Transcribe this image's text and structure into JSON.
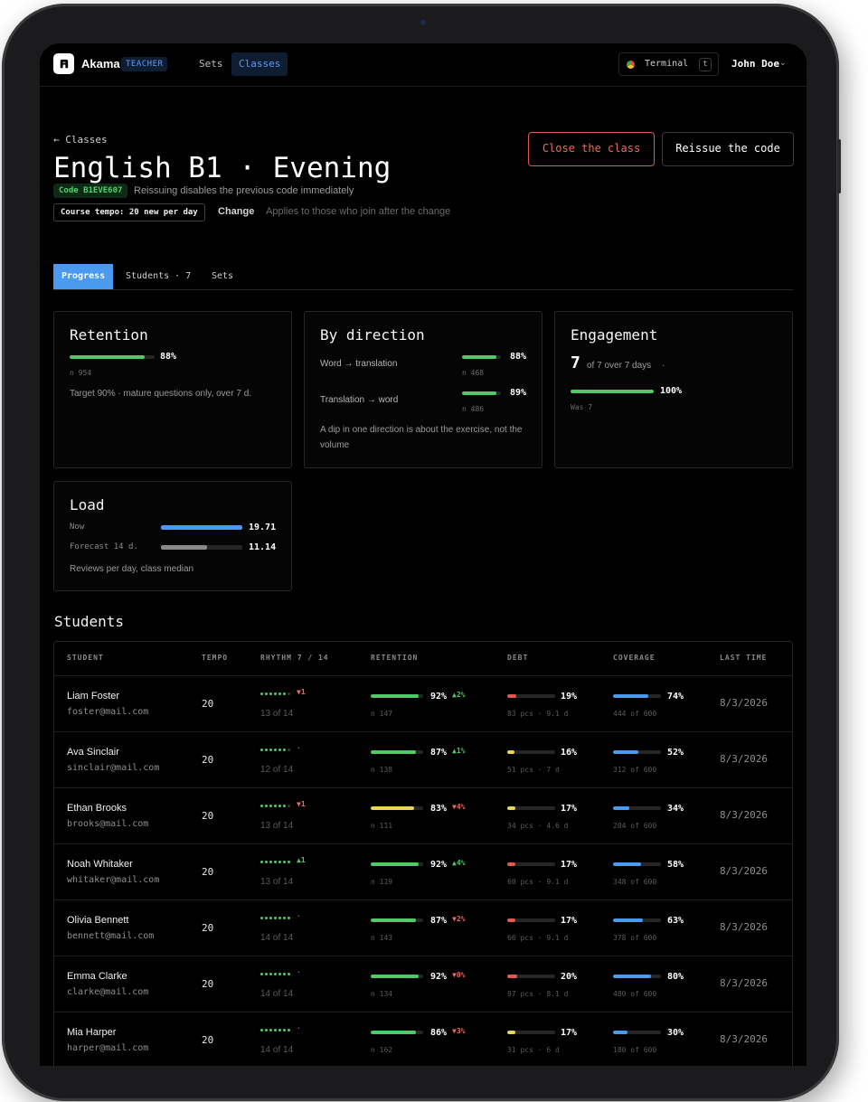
{
  "header": {
    "brand": "Akama",
    "role": "TEACHER",
    "nav": [
      {
        "label": "Sets",
        "active": false
      },
      {
        "label": "Classes",
        "active": true
      }
    ],
    "terminal_label": "Terminal",
    "terminal_key": "t",
    "user_name": "John Doe"
  },
  "page": {
    "back_label": "← Classes",
    "title": "English B1 · Evening",
    "code_label": "Code B1EVE607",
    "code_note": "Reissuing disables the previous code immediately",
    "tempo_label": "Course tempo: 20 new per day",
    "change_label": "Change",
    "change_note": "Applies to those who join after the change",
    "close_button": "Close the class",
    "reissue_button": "Reissue the code"
  },
  "tabs": [
    {
      "label": "Progress",
      "active": true
    },
    {
      "label": "Students · 7",
      "active": false
    },
    {
      "label": "Sets",
      "active": false
    }
  ],
  "retention": {
    "title": "Retention",
    "value": 88,
    "value_label": "88%",
    "n_label": "n 954",
    "note": "Target 90% · mature questions only, over 7 d."
  },
  "direction": {
    "title": "By direction",
    "items": [
      {
        "label": "Word → translation",
        "value": 88,
        "value_label": "88%",
        "n_label": "n 468"
      },
      {
        "label": "Translation → word",
        "value": 89,
        "value_label": "89%",
        "n_label": "n 486"
      }
    ],
    "note": "A dip in one direction is about the exercise, not the volume"
  },
  "engagement": {
    "title": "Engagement",
    "big_number": "7",
    "sub": "of 7 over 7 days",
    "sub_dot": "·",
    "value": 100,
    "value_label": "100%",
    "was_label": "Was 7"
  },
  "load": {
    "title": "Load",
    "rows": [
      {
        "label": "Now",
        "value": 19.71,
        "value_label": "19.71",
        "fill": 1.0
      },
      {
        "label": "Forecast 14 d.",
        "value": 11.14,
        "value_label": "11.14",
        "fill": 0.57
      }
    ],
    "note": "Reviews per day, class median"
  },
  "students": {
    "title": "Students",
    "columns": [
      "STUDENT",
      "TEMPO",
      "RHYTHM 7 / 14",
      "RETENTION",
      "DEBT",
      "COVERAGE",
      "LAST TIME"
    ],
    "rows": [
      {
        "name": "Liam Foster",
        "email": "foster@mail.com",
        "tempo": "20",
        "dots_on": 6,
        "rhythm_delta": "▼1",
        "rhythm_dir": "down",
        "rhythm_sub": "13 of 14",
        "retention": 92,
        "retention_label": "92%",
        "retention_delta": "▲2%",
        "retention_dir": "up",
        "retention_color": "g",
        "retention_n": "n 147",
        "debt": 19,
        "debt_label": "19%",
        "debt_color": "r",
        "debt_sub": "83 pcs · 9.1 d",
        "coverage": 74,
        "coverage_label": "74%",
        "coverage_sub": "444 of 600",
        "last": "8/3/2026"
      },
      {
        "name": "Ava Sinclair",
        "email": "sinclair@mail.com",
        "tempo": "20",
        "dots_on": 6,
        "rhythm_delta": "·",
        "rhythm_dir": "flat",
        "rhythm_sub": "12 of 14",
        "retention": 87,
        "retention_label": "87%",
        "retention_delta": "▲1%",
        "retention_dir": "up",
        "retention_color": "g",
        "retention_n": "n 138",
        "debt": 16,
        "debt_label": "16%",
        "debt_color": "y",
        "debt_sub": "51 pcs · 7 d",
        "coverage": 52,
        "coverage_label": "52%",
        "coverage_sub": "312 of 600",
        "last": "8/3/2026"
      },
      {
        "name": "Ethan Brooks",
        "email": "brooks@mail.com",
        "tempo": "20",
        "dots_on": 6,
        "rhythm_delta": "▼1",
        "rhythm_dir": "down",
        "rhythm_sub": "13 of 14",
        "retention": 83,
        "retention_label": "83%",
        "retention_delta": "▼4%",
        "retention_dir": "down",
        "retention_color": "y",
        "retention_n": "n 111",
        "debt": 17,
        "debt_label": "17%",
        "debt_color": "y",
        "debt_sub": "34 pcs · 4.6 d",
        "coverage": 34,
        "coverage_label": "34%",
        "coverage_sub": "204 of 600",
        "last": "8/3/2026"
      },
      {
        "name": "Noah Whitaker",
        "email": "whitaker@mail.com",
        "tempo": "20",
        "dots_on": 7,
        "rhythm_delta": "▲1",
        "rhythm_dir": "up",
        "rhythm_sub": "13 of 14",
        "retention": 92,
        "retention_label": "92%",
        "retention_delta": "▲4%",
        "retention_dir": "up",
        "retention_color": "g",
        "retention_n": "n 119",
        "debt": 17,
        "debt_label": "17%",
        "debt_color": "r",
        "debt_sub": "60 pcs · 9.1 d",
        "coverage": 58,
        "coverage_label": "58%",
        "coverage_sub": "348 of 600",
        "last": "8/3/2026"
      },
      {
        "name": "Olivia Bennett",
        "email": "bennett@mail.com",
        "tempo": "20",
        "dots_on": 7,
        "rhythm_delta": "·",
        "rhythm_dir": "flat",
        "rhythm_sub": "14 of 14",
        "retention": 87,
        "retention_label": "87%",
        "retention_delta": "▼2%",
        "retention_dir": "down",
        "retention_color": "g",
        "retention_n": "n 143",
        "debt": 17,
        "debt_label": "17%",
        "debt_color": "r",
        "debt_sub": "66 pcs · 9.1 d",
        "coverage": 63,
        "coverage_label": "63%",
        "coverage_sub": "378 of 600",
        "last": "8/3/2026"
      },
      {
        "name": "Emma Clarke",
        "email": "clarke@mail.com",
        "tempo": "20",
        "dots_on": 7,
        "rhythm_delta": "·",
        "rhythm_dir": "flat",
        "rhythm_sub": "14 of 14",
        "retention": 92,
        "retention_label": "92%",
        "retention_delta": "▼0%",
        "retention_dir": "down",
        "retention_color": "g",
        "retention_n": "n 134",
        "debt": 20,
        "debt_label": "20%",
        "debt_color": "r",
        "debt_sub": "97 pcs · 8.1 d",
        "coverage": 80,
        "coverage_label": "80%",
        "coverage_sub": "480 of 600",
        "last": "8/3/2026"
      },
      {
        "name": "Mia Harper",
        "email": "harper@mail.com",
        "tempo": "20",
        "dots_on": 7,
        "rhythm_delta": "·",
        "rhythm_dir": "flat",
        "rhythm_sub": "14 of 14",
        "retention": 86,
        "retention_label": "86%",
        "retention_delta": "▼3%",
        "retention_dir": "down",
        "retention_color": "g",
        "retention_n": "n 162",
        "debt": 17,
        "debt_label": "17%",
        "debt_color": "y",
        "debt_sub": "31 pcs · 6 d",
        "coverage": 30,
        "coverage_label": "30%",
        "coverage_sub": "180 of 600",
        "last": "8/3/2026"
      }
    ]
  },
  "colors": {
    "accent": "#4a9af0",
    "good": "#52c968",
    "warn": "#e8d55a",
    "bad": "#e0584f",
    "background": "#000000"
  }
}
